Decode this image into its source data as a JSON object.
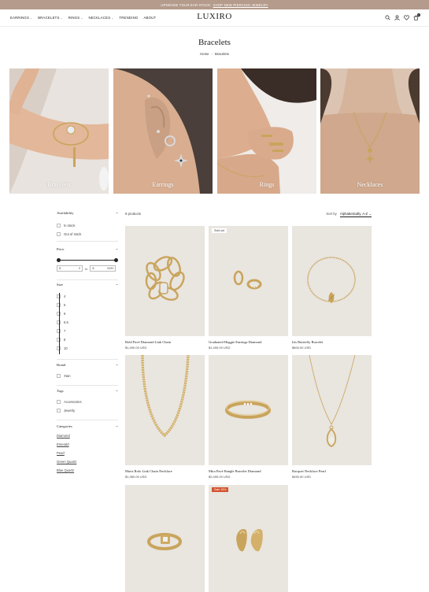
{
  "announcement": {
    "text": "UPGRADE YOUR EAR STACK:",
    "link": "SHOP NEW PIERCING JEWELRY"
  },
  "header": {
    "logo": "LUXIRO",
    "nav": [
      {
        "label": "EARRINGS",
        "has_menu": true
      },
      {
        "label": "BRACELETS",
        "has_menu": true
      },
      {
        "label": "RINGS",
        "has_menu": true
      },
      {
        "label": "NECKLACES",
        "has_menu": true
      },
      {
        "label": "TRENDING",
        "has_menu": false
      },
      {
        "label": "ABOUT",
        "has_menu": false
      }
    ],
    "icons": [
      "search-icon",
      "account-icon",
      "wishlist-icon",
      "cart-icon"
    ],
    "cart_count": "0"
  },
  "page": {
    "title": "Bracelets",
    "breadcrumb": [
      "Home",
      "Bracelets"
    ]
  },
  "categories": [
    {
      "label": "Bracelets"
    },
    {
      "label": "Earrings"
    },
    {
      "label": "Rings"
    },
    {
      "label": "Necklaces"
    }
  ],
  "filters": {
    "availability": {
      "title": "Availability",
      "options": [
        "In stock",
        "Out of stock"
      ]
    },
    "price": {
      "title": "Price",
      "currency": "$",
      "min": "0",
      "max": "3490",
      "to": "to"
    },
    "size": {
      "title": "Size",
      "options": [
        "4",
        "5",
        "6",
        "6.5",
        "7",
        "8",
        "10"
      ]
    },
    "brand": {
      "title": "Brand",
      "options": [
        "Xtan"
      ]
    },
    "tags": {
      "title": "Tags",
      "options": [
        "Accessories",
        "Jewelry"
      ]
    },
    "categories": {
      "title": "Categories",
      "links": [
        "Diamond",
        "Emerald",
        "Pearl",
        "Green Quartz",
        "Blue Quartz"
      ]
    }
  },
  "toolbar": {
    "count": "9 products",
    "sort_label": "Sort by",
    "sort_value": "Alphabetically, A-Z"
  },
  "products": [
    {
      "name": "Bold Pavé Diamond Link Chain",
      "price": "$1,490.00 USD",
      "badge": ""
    },
    {
      "name": "Graduated Huggie Earrings Diamond",
      "price": "$1,490.00 USD",
      "badge": "Sold out"
    },
    {
      "name": "Iris Butterfly Bracelet",
      "price": "$600.00 USD",
      "badge": ""
    },
    {
      "name": "Maris Rolo Link Chain Necklace",
      "price": "$1,360.00 USD",
      "badge": ""
    },
    {
      "name": "Mira Pavé Bangle Bracelet Diamond",
      "price": "$2,490.00 USD",
      "badge": ""
    },
    {
      "name": "Racquet Necklace Pearl",
      "price": "$450.00 USD",
      "badge": ""
    },
    {
      "name": "",
      "price": "",
      "badge": ""
    },
    {
      "name": "",
      "price": "",
      "badge": "Sale 15%"
    }
  ],
  "colors": {
    "announcement_bg": "#b49b8b",
    "product_bg": "#e9e5df",
    "sale_badge": "#d2542f",
    "gold": "#c9a45c"
  }
}
